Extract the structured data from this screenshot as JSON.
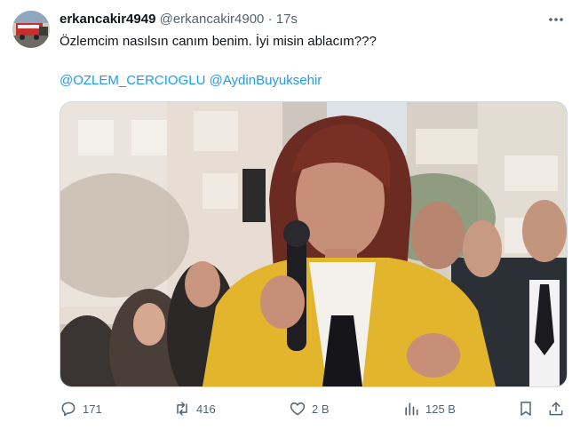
{
  "tweet": {
    "display_name": "erkancakir4949",
    "handle": "@erkancakir4900",
    "separator": "·",
    "time": "17s",
    "text": "Özlemcim nasılsın canım benim. İyi misin ablacım???",
    "mentions": [
      "@OZLEM_CERCIOGLU",
      "@AydinBuyuksehir"
    ]
  },
  "actions": {
    "replies": "171",
    "reposts": "416",
    "likes": "2 B",
    "views": "125 B"
  },
  "icons": {
    "more": "more-icon",
    "reply": "reply-icon",
    "repost": "repost-icon",
    "like": "heart-icon",
    "views": "bar-chart-icon",
    "bookmark": "bookmark-icon",
    "share": "share-icon"
  },
  "colors": {
    "link": "#1d9bf0",
    "secondary_text": "#536471",
    "blazer": "#e3b52c"
  }
}
